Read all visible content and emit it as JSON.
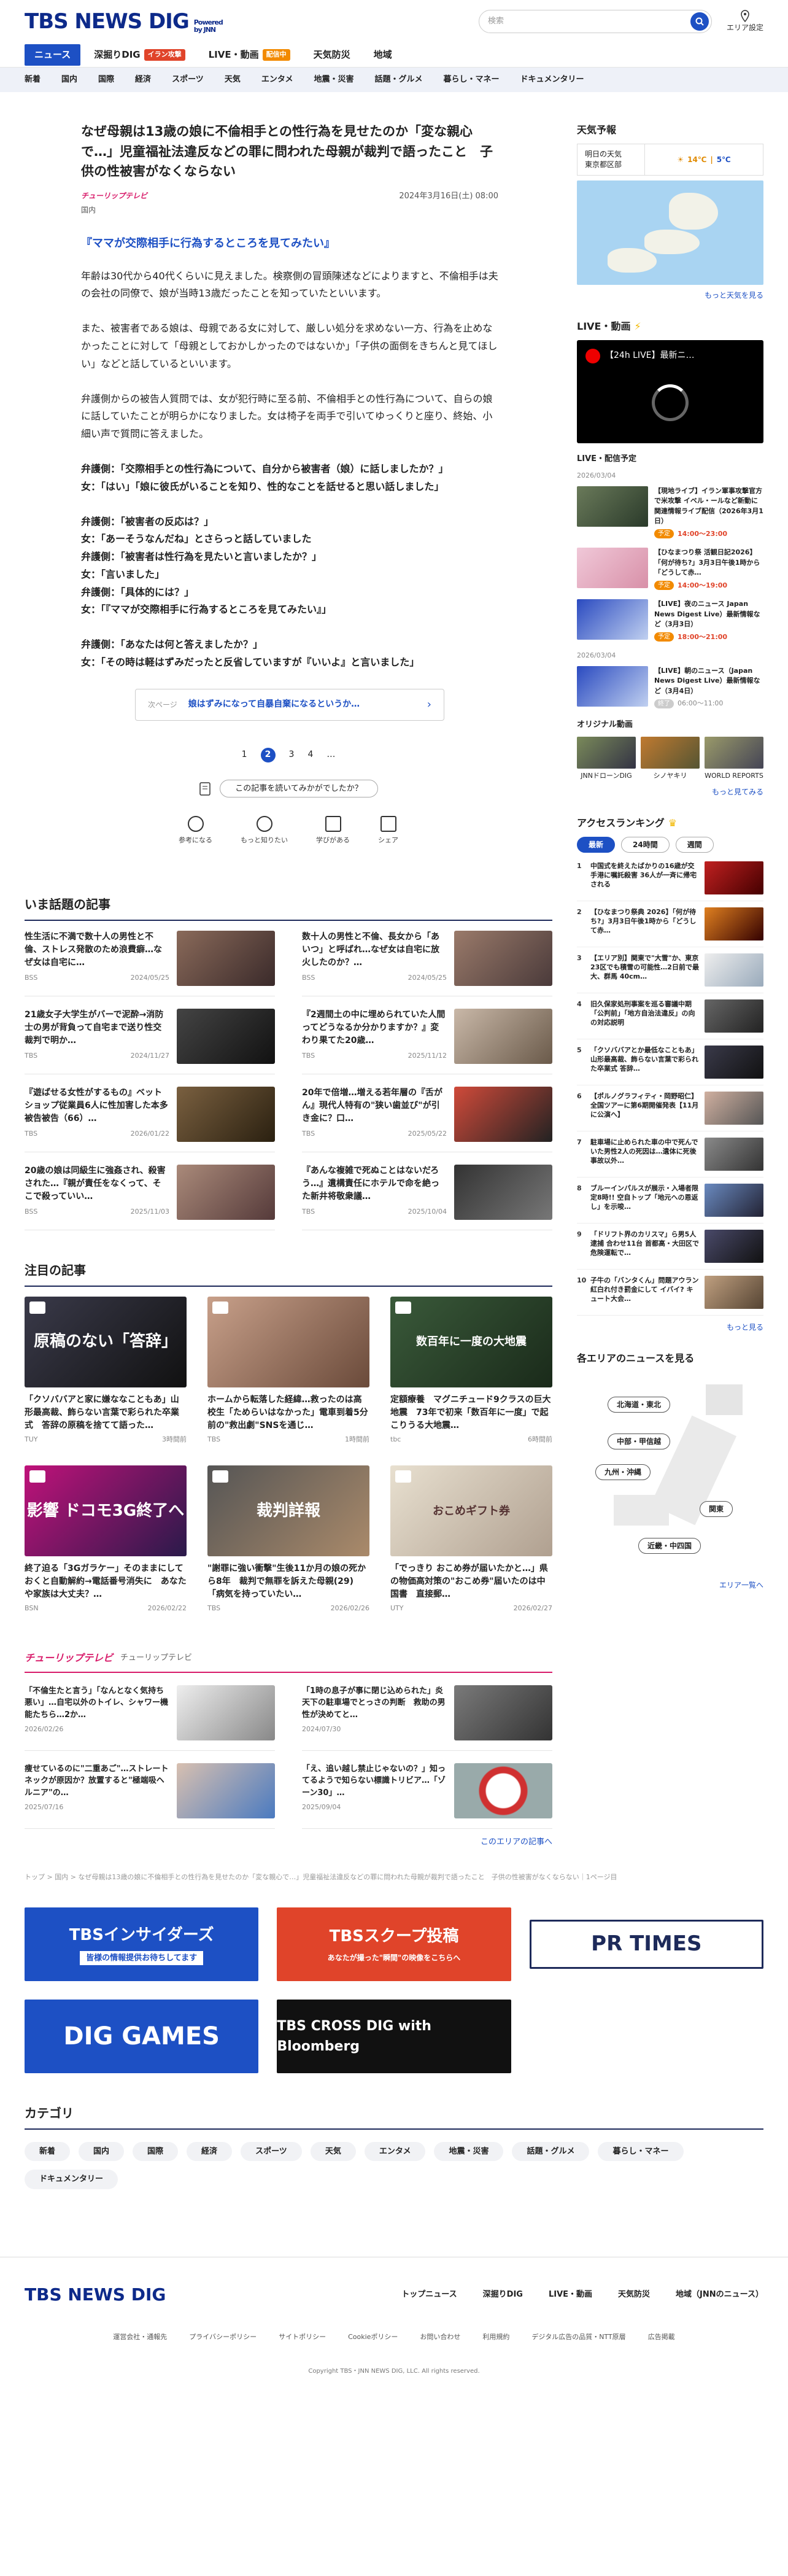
{
  "header": {
    "logo": "TBS NEWS DIG",
    "powered": "Powered by JNN",
    "search_placeholder": "検索",
    "area_label": "エリア設定"
  },
  "nav1": [
    {
      "label": "ニュース",
      "active": true
    },
    {
      "label": "深掘りDIG",
      "badge": "イラン攻撃"
    },
    {
      "label": "LIVE・動画",
      "badge": "配信中",
      "badge_color": "orange"
    },
    {
      "label": "天気防災"
    },
    {
      "label": "地域"
    }
  ],
  "nav2": [
    "新着",
    "国内",
    "国際",
    "経済",
    "スポーツ",
    "天気",
    "エンタメ",
    "地震・災害",
    "話題・グルメ",
    "暮らし・マネー",
    "ドキュメンタリー"
  ],
  "article": {
    "title": "なぜ母親は13歳の娘に不倫相手との性行為を見せたのか「変な親心で…」児童福祉法違反などの罪に問われた母親が裁判で語ったこと　子供の性被害がなくならない",
    "source": "チューリップテレビ",
    "date": "2024年3月16日(土) 08:00",
    "category": "国内",
    "heading": "『ママが交際相手に行為するところを見てみたい』",
    "paragraphs": [
      "年齢は30代から40代くらいに見えました。検察側の冒頭陳述などによりますと、不倫相手は夫の会社の同僚で、娘が当時13歳だったことを知っていたといいます。",
      "また、被害者である娘は、母親である女に対して、厳しい処分を求めない一方、行為を止めなかったことに対して「母親としておかしかったのではないか」「子供の面倒をきちんと見てほしい」などと話しているといいます。",
      "弁護側からの被告人質問では、女が犯行時に至る前、不倫相手との性行為について、自らの娘に話していたことが明らかになりました。女は椅子を両手で引いてゆっくりと座り、終始、小細い声で質問に答えました。"
    ],
    "qa1": [
      "弁護側：「交際相手との性行為について、自分から被害者（娘）に話しましたか？」",
      "女：「はい」「娘に彼氏がいることを知り、性的なことを話せると思い話しました」"
    ],
    "qa2": [
      "弁護側：「被害者の反応は？」",
      "女：「あーそうなんだね」とさらっと話していました",
      "弁護側：「被害者は性行為を見たいと言いましたか？」",
      "女：「言いました」",
      "弁護側：「具体的には？」",
      "女：「『ママが交際相手に行為するところを見てみたい』」"
    ],
    "qa3": [
      "弁護側：「あなたは何と答えましたか？」",
      "女：「その時は軽はずみだったと反省していますが『いいよ』と言いました」"
    ],
    "next_label": "次ページ",
    "next_text": "娘はずみになって自暴自棄になるというか…",
    "pages": [
      "1",
      "2",
      "3",
      "4",
      "…"
    ],
    "survey": "この記事を読いてみかがでしたか？",
    "reactions": [
      "参考になる",
      "もっと知りたい",
      "学びがある",
      "シェア"
    ]
  },
  "popular": {
    "title": "いま話題の記事",
    "items": [
      {
        "t": "性生活に不満で数十人の男性と不倫、ストレス発散のため浪費癖…なぜ女は自宅に…",
        "src": "BSS",
        "date": "2024/05/25"
      },
      {
        "t": "数十人の男性と不倫、長女から「あいつ」と呼ばれ…なぜ女は自宅に放火したのか？…",
        "src": "BSS",
        "date": "2024/05/25"
      },
      {
        "t": "21歳女子大学生がバーで泥酔→消防士の男が背負って自宅まで送り性交　裁判で明か…",
        "src": "TBS",
        "date": "2024/11/27"
      },
      {
        "t": "『2週間土の中に埋められていた人間ってどうなるか分かりますか？』変わり果てた20歳…",
        "src": "TBS",
        "date": "2025/11/12"
      },
      {
        "t": "『遊ばせる女性がするもの』ベットショップ従業員6人に性加害した本多被告被告（66）…",
        "src": "TBS",
        "date": "2026/01/22"
      },
      {
        "t": "20年で倍増…増える若年層の『舌がん』現代人特有の\"狭い歯並び\"が引き金に？口…",
        "src": "TBS",
        "date": "2025/05/22"
      },
      {
        "t": "20歳の娘は同級生に強姦され、殺害された…『親が責任をなくって、そこで殺っていい…",
        "src": "BSS",
        "date": "2025/11/03"
      },
      {
        "t": "『あんな複雑で死ぬことはないだろう…』遺構責任にホテルで命を絶った新井将敬衆議…",
        "src": "TBS",
        "date": "2025/10/04"
      }
    ]
  },
  "featured": {
    "title": "注目の記事",
    "items": [
      {
        "t": "「クソババアと家に嫌ななこともあ」山形最高裁、飾らない言葉で彩られた卒業式　答辞の原稿を捨てて語った…",
        "src": "TUY",
        "date": "3時間前",
        "cap": "原稿のない「答辞」"
      },
      {
        "t": "ホームから転落した経緯…救ったのは高校生「ためらいはなかった」電車到着5分前の\"救出劇\"SNSを通じ…",
        "src": "TBS",
        "date": "1時間前",
        "cap": ""
      },
      {
        "t": "定額療養　マグニチュード9クラスの巨大地震　73年で初来「数百年に一度」で起こりうる大地震…",
        "src": "tbc",
        "date": "6時間前",
        "cap": "数百年に一度の大地震"
      },
      {
        "t": "終了迫る「3Gガラケー」そのままにしておくと自動解約→電話番号消失に　あなたや家族は大丈夫？…",
        "src": "BSN",
        "date": "2026/02/22",
        "cap": "影響 ドコモ3G終了へ"
      },
      {
        "t": "\"謝罪に強い衝撃\"生後11か月の娘の死から8年　裁判で無罪を訴えた母親(29)「病気を持っていたい…",
        "src": "TBS",
        "date": "2026/02/26",
        "cap": "裁判詳報"
      },
      {
        "t": "「でっきり おこめ券が届いたかと…」県の物価高対策の\"おこめ券\"届いたのは中国書　直接郵…",
        "src": "UTY",
        "date": "2026/02/27",
        "cap": "おこめギフト券"
      }
    ]
  },
  "channel": {
    "logo": "チューリップテレビ",
    "name": "チューリップテレビ",
    "items": [
      {
        "t": "「不倫生たと言う」「なんとなく気持ち悪い」…自宅以外のトイレ、シャワー機能たちら…2か…",
        "date": "2026/02/26"
      },
      {
        "t": "「1時の息子が事に閉じ込められた」炎天下の駐車場でとっさの判断　救助の男性が決めてと…",
        "date": "2024/07/30"
      },
      {
        "t": "痩せているのに\"二重あご\"…ストレートネックが原因か？放置すると\"極端吸ヘルニア\"の…",
        "date": "2025/07/16"
      },
      {
        "t": "「え、追い越し禁止じゃないの？」知ってるようで知らない標識トリビア…「ゾーン30」…",
        "date": "2025/09/04"
      }
    ],
    "more": "このエリアの記事へ"
  },
  "breadcrumb": "トップ > 国内 > なぜ母親は13歳の娘に不倫相手との性行為を見せたのか「変な親心で…」児童福祉法違反などの罪に問われた母親が裁判で語ったこと　子供の性被害がなくならない｜1ページ目",
  "banners": [
    "TBSインサイダーズ",
    "TBSスクープ投稿",
    "PR TIMES",
    "DIG GAMES",
    "TBS CROSS DIG with Bloomberg"
  ],
  "banner_sub": [
    "皆様の情報提供お待ちしてます",
    "あなたが撮った\"瞬間\"の映像をこちらへ"
  ],
  "categories": {
    "title": "カテゴリ",
    "items": [
      "新着",
      "国内",
      "国際",
      "経済",
      "スポーツ",
      "天気",
      "エンタメ",
      "地震・災害",
      "話題・グルメ",
      "暮らし・マネー",
      "ドキュメンタリー"
    ]
  },
  "footer": {
    "logo": "TBS NEWS DIG",
    "links": [
      "トップニュース",
      "深掘りDIG",
      "LIVE・動画",
      "天気防災",
      "地域（JNNのニュース）"
    ],
    "sub": [
      "運営会社・通報先",
      "プライバシーポリシー",
      "サイトポリシー",
      "Cookieポリシー",
      "お問い合わせ",
      "利用規約",
      "デジタル広告の品質・NTT原層",
      "広告掲載"
    ],
    "copy": "Copyright TBS・JNN NEWS DIG, LLC. All rights reserved."
  },
  "side": {
    "weather": {
      "title": "天気予報",
      "label": "明日の天気\n東京都区部",
      "hi": "14℃",
      "lo": "5℃",
      "more": "もっと天気を見る"
    },
    "live": {
      "title": "LIVE・動画",
      "video_title": "【24h LIVE】最新ニ…",
      "sched_title": "LIVE・配信予定",
      "date1": "2026/03/04",
      "date2": "2026/03/04",
      "items": [
        {
          "t": "【現地ライブ】イラン軍事攻撃官方で米攻撃 イベル・ールなど新動に関連情報ライブ配信（2026年3月1日）",
          "tag": "予定",
          "time": "14:00～23:00"
        },
        {
          "t": "【ひなまつり祭 活観日記2026】「何が待ち?」3月3日午後1時から「どうして赤…",
          "tag": "予定",
          "time": "14:00～19:00"
        },
        {
          "t": "【LIVE】夜のニュース Japan News Digest Live）最新情報など（3月3日）",
          "tag": "予定",
          "time": "18:00～21:00"
        },
        {
          "t": "【LIVE】朝のニュース（Japan News Digest Live）最新情報など（3月4日）",
          "tag": "終了",
          "time": "06:00～11:00"
        }
      ]
    },
    "original": {
      "title": "オリジナル動画",
      "items": [
        "JNNドローンDIG",
        "シノヤキリ",
        "WORLD REPORTS"
      ],
      "more": "もっと見てみる"
    },
    "ranking": {
      "title": "アクセスランキング",
      "tabs": [
        "最新",
        "24時間",
        "週間"
      ],
      "items": [
        "中国式を終えたばかりの16歳が交手港に嘱託殺害 36人が一斉に帰宅される",
        "【ひなまつり祭典 2026】「何が待ち?」3月3日午後1時から「どうして赤…",
        "【エリア別】関東で\"大雪\"か、東京23区でも積雪の可能性…2日前で最大、群馬 40cm…",
        "旧久保家処刑事案を巡る審議中期「公判前」「地方自治法違反」の向の対応説明",
        "「クソババアとか最低なこともあ」山形最高裁、飾らない言葉で彩られた卒業式 答辞…",
        "【ポルノグラフィティ・岡野昭仁】全国ツアーに第6期開催発表【11月に公演へ】",
        "駐車場に止められた車の中で死んでいた男性2人の死因は…遺体に死後 事故以外…",
        "ブルーインパルスが展示・入場者限定8時!! 空自トップ「地元への恩返し」を示唆…",
        "「ドリフト界のカリスマ」ら男5人逮捕 合わせ11台 首都高・大田区で危険運転で…",
        "子牛の「バンタくん」問題アウラン紅白れ付き罰金にして イバイ? キュート大会…"
      ],
      "more": "もっと見る"
    },
    "areas": {
      "title": "各エリアのニュースを見る",
      "btns": [
        "北海道・東北",
        "中部・甲信越",
        "九州・沖縄",
        "関東",
        "近畿・中四国"
      ],
      "more": "エリア一覧へ"
    }
  }
}
